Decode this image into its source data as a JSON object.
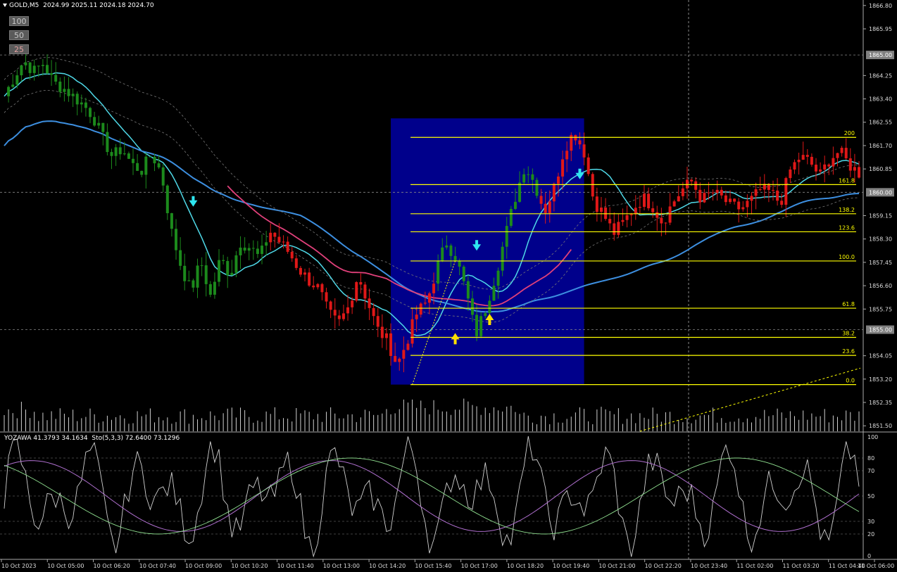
{
  "header": {
    "symbol": "GOLD,M5",
    "ohlc": "2024.99 2025.11 2024.18 2024.70"
  },
  "zoom_buttons": [
    "100",
    "50",
    "25"
  ],
  "subwindow": {
    "indicator_label": "YOZAWA 41.3793 34.1634",
    "stoch_label": "Sto(5,3,3) 72.6400 73.1296"
  },
  "colors": {
    "background": "#000000",
    "bull_candle": "#1c8a1c",
    "bear_candle": "#e01818",
    "fib_line": "#ffff00",
    "fib_box": "#00008b",
    "ma_cyan": "#4fd9e8",
    "ma_blue": "#3d8fe0",
    "ma_pink": "#e0407a",
    "signal_cyan": "#2ee6f0",
    "signal_yellow": "#ffe000"
  },
  "chart_data": {
    "type": "candlestick",
    "instrument": "GOLD",
    "timeframe": "M5",
    "price_axis_labels": [
      "1866.80",
      "1865.95",
      "1864.25",
      "1863.40",
      "1862.55",
      "1861.70",
      "1860.85",
      "1859.15",
      "1858.30",
      "1857.45",
      "1856.60",
      "1855.75",
      "1854.05",
      "1853.20",
      "1852.35",
      "1851.50"
    ],
    "price_axis_range": [
      1851.3,
      1867.0
    ],
    "highlighted_prices": [
      "1865.00",
      "1860.00",
      "1855.00"
    ],
    "time_axis_labels": [
      "10 Oct 2023",
      "10 Oct 05:00",
      "10 Oct 06:20",
      "10 Oct 07:40",
      "10 Oct 09:00",
      "10 Oct 10:20",
      "10 Oct 11:40",
      "10 Oct 13:00",
      "10 Oct 14:20",
      "10 Oct 15:40",
      "10 Oct 17:00",
      "10 Oct 18:20",
      "10 Oct 19:40",
      "10 Oct 21:00",
      "10 Oct 22:20",
      "10 Oct 23:40",
      "11 Oct 02:00",
      "11 Oct 03:20",
      "11 Oct 04:40",
      "11 Oct 06:00"
    ],
    "fibonacci_levels": [
      "200",
      "161.8",
      "138.2",
      "123.6",
      "100.0",
      "61.8",
      "38.2",
      "23.6",
      "0.0"
    ],
    "fibonacci_values": [
      200,
      161.8,
      138.2,
      123.6,
      100.0,
      61.8,
      38.2,
      23.6,
      0.0
    ],
    "fibonacci_base": {
      "level_0_price": 1853.0,
      "level_100_price": 1857.5
    },
    "oscillator_axis_labels": [
      "100",
      "80",
      "70",
      "50",
      "30",
      "20",
      "0"
    ],
    "oscillator_range": [
      0,
      100
    ],
    "price_path": [
      1863.5,
      1864.2,
      1864.8,
      1864.4,
      1864.7,
      1864.0,
      1863.8,
      1863.5,
      1863.2,
      1862.8,
      1862.0,
      1861.3,
      1861.6,
      1861.0,
      1860.8,
      1861.4,
      1860.7,
      1858.6,
      1857.3,
      1856.4,
      1857.5,
      1856.2,
      1857.6,
      1857.0,
      1858.2,
      1858.0,
      1857.6,
      1858.6,
      1858.2,
      1857.8,
      1857.2,
      1856.8,
      1856.5,
      1855.6,
      1855.2,
      1855.8,
      1857.0,
      1856.0,
      1855.0,
      1854.6,
      1853.7,
      1854.6,
      1855.6,
      1856.0,
      1857.2,
      1858.2,
      1857.6,
      1856.4,
      1854.8,
      1855.8,
      1857.0,
      1858.4,
      1859.8,
      1861.0,
      1860.3,
      1859.3,
      1860.2,
      1861.6,
      1862.2,
      1861.5,
      1859.7,
      1859.2,
      1858.5,
      1858.9,
      1859.4,
      1859.8,
      1859.5,
      1858.9,
      1859.6,
      1860.1,
      1860.4,
      1859.7,
      1860.0,
      1859.8,
      1859.5,
      1859.4,
      1859.7,
      1860.1,
      1860.0,
      1859.6,
      1860.8,
      1861.3,
      1861.1,
      1860.6,
      1861.2,
      1861.5,
      1861.0,
      1860.7
    ]
  }
}
